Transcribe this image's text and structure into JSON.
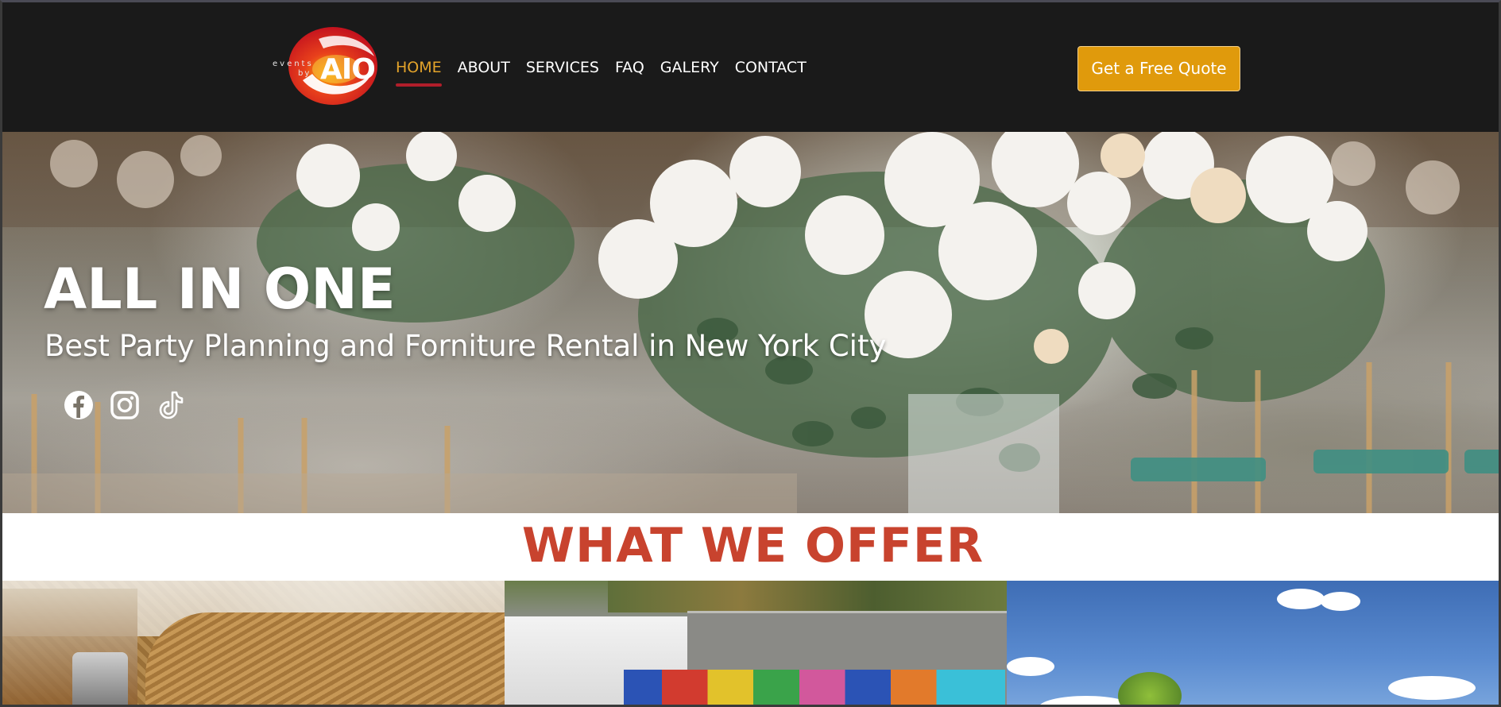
{
  "brand": {
    "logo_small_top": "events",
    "logo_small_bottom": "by",
    "logo_main": "AIO"
  },
  "nav": {
    "items": [
      {
        "label": "HOME",
        "active": true
      },
      {
        "label": "ABOUT",
        "active": false
      },
      {
        "label": "SERVICES",
        "active": false
      },
      {
        "label": "FAQ",
        "active": false
      },
      {
        "label": "GALERY",
        "active": false
      },
      {
        "label": "CONTACT",
        "active": false
      }
    ],
    "cta_label": "Get a Free Quote"
  },
  "hero": {
    "title": "ALL IN ONE",
    "subtitle": "Best Party Planning and Forniture Rental in New York City",
    "socials": [
      {
        "name": "facebook-icon"
      },
      {
        "name": "instagram-icon"
      },
      {
        "name": "tiktok-icon"
      }
    ]
  },
  "offer": {
    "heading": "WHAT WE OFFER"
  },
  "colors": {
    "header_bg": "#1a1a1a",
    "nav_active": "#e3a32a",
    "nav_underline": "#b01e2a",
    "cta_bg": "#e09a0c",
    "offer_heading": "#c8432e"
  }
}
